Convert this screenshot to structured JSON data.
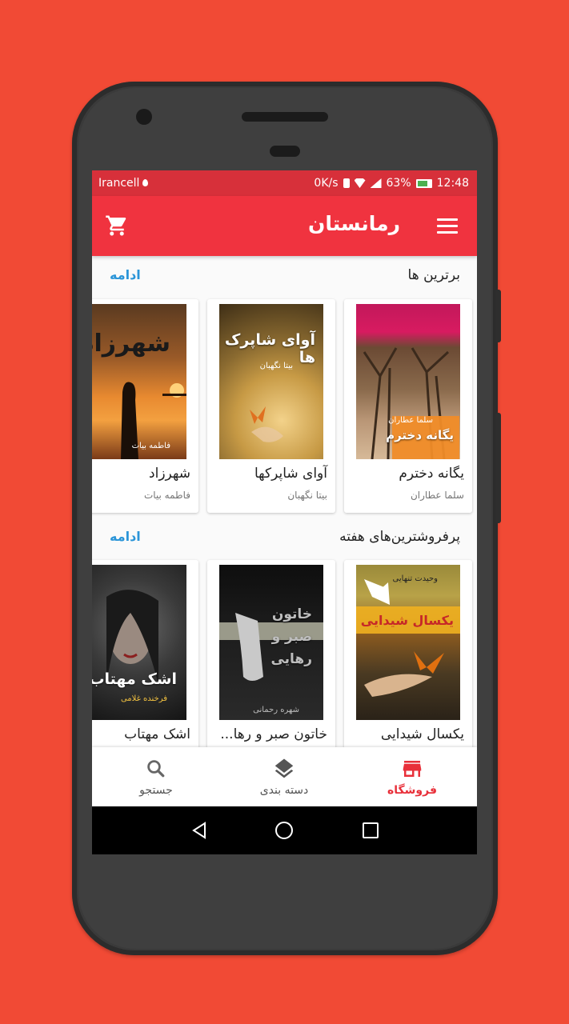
{
  "status_bar": {
    "carrier": "Irancell",
    "speed": "0K/s",
    "battery": "63%",
    "time": "12:48"
  },
  "app_bar": {
    "title": "رمانستان"
  },
  "sections": [
    {
      "title": "برترین ها",
      "more": "ادامه",
      "books": [
        {
          "title": "یگانه دخترم",
          "author": "سلما عطاران",
          "cover_text": "یگانه دخترم",
          "cover_author": "سلما عطاران"
        },
        {
          "title": "آوای شاپرکها",
          "author": "بیتا نگهبان",
          "cover_text": "آوای شاپرک ها",
          "cover_author": "بیتا نگهبان"
        },
        {
          "title": "شهرزاد",
          "author": "فاطمه بیات",
          "cover_text": "شهرزاد",
          "cover_author": "فاطمه بیات"
        }
      ]
    },
    {
      "title": "پرفروشترین‌های هفته",
      "more": "ادامه",
      "books": [
        {
          "title": "یکسال شیدایی",
          "cover_text": "یکسال شیدایی",
          "cover_author": "وحیدت تنهایی"
        },
        {
          "title": "خاتون صبر و رها...",
          "cover_text": "خاتون صبر و رهایی",
          "cover_author": "شهره رحمانی"
        },
        {
          "title": "اشک مهتاب",
          "cover_text": "اشک مهتاب",
          "cover_author": "فرخنده غلامی"
        }
      ]
    }
  ],
  "bottom_nav": {
    "store": "فروشگاه",
    "categories": "دسته بندی",
    "search": "جستجو"
  },
  "colors": {
    "background": "#f14a35",
    "accent": "#f0333f",
    "link": "#2b95d8"
  }
}
